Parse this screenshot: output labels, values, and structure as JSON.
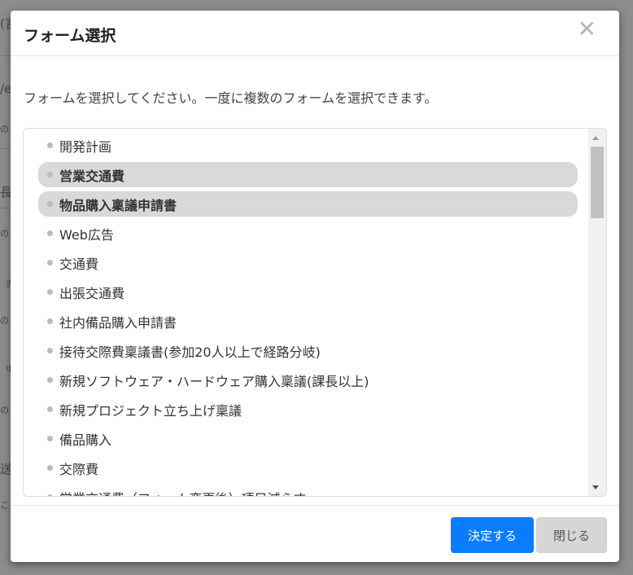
{
  "background": {
    "fragments": [
      "(言",
      "/e",
      "の",
      "長",
      "赤",
      "の",
      "中",
      "の",
      "送",
      "の",
      "こ"
    ]
  },
  "modal": {
    "title": "フォーム選択",
    "close_icon": "close-icon",
    "instruction": "フォームを選択してください。一度に複数のフォームを選択できます。",
    "items": [
      {
        "label": "開発計画",
        "selected": false
      },
      {
        "label": "営業交通費",
        "selected": true
      },
      {
        "label": "物品購入稟議申請書",
        "selected": true
      },
      {
        "label": "Web広告",
        "selected": false
      },
      {
        "label": "交通費",
        "selected": false
      },
      {
        "label": "出張交通費",
        "selected": false
      },
      {
        "label": "社内備品購入申請書",
        "selected": false
      },
      {
        "label": "接待交際費稟議書(参加20人以上で経路分岐)",
        "selected": false
      },
      {
        "label": "新規ソフトウェア・ハードウェア購入稟議(課長以上)",
        "selected": false
      },
      {
        "label": "新規プロジェクト立ち上げ稟議",
        "selected": false
      },
      {
        "label": "備品購入",
        "selected": false
      },
      {
        "label": "交際費",
        "selected": false
      },
      {
        "label": "営業交通費（フォーム変更後）項目減らす",
        "selected": false
      }
    ],
    "buttons": {
      "confirm": "決定する",
      "close": "閉じる"
    },
    "colors": {
      "primary": "#0a7cff",
      "selected_bg": "#d9d9d9"
    }
  }
}
